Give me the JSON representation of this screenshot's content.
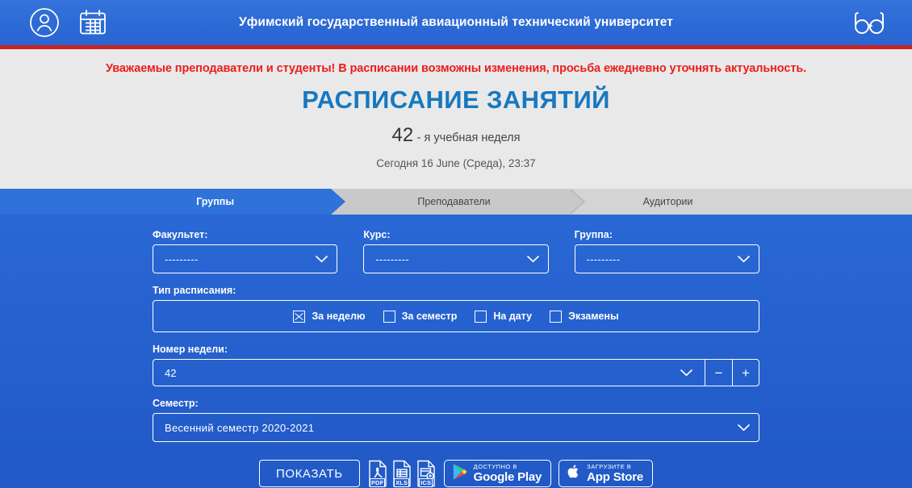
{
  "header": {
    "title": "Уфимский государственный авиационный технический университет",
    "user_icon": "user-circle-icon",
    "calendar_icon": "calendar-icon",
    "accessibility_icon": "glasses-icon",
    "bg_color": "#2c6ad6",
    "rule_color": "#cb2424"
  },
  "notice": {
    "text": "Уважаемые преподаватели и студенты! В расписании возможны изменения, просьба ежедневно уточнять актуальность.",
    "color": "#ee1c1c"
  },
  "page": {
    "title": "РАСПИСАНИЕ ЗАНЯТИЙ",
    "title_color": "#1778c0",
    "week_number": "42",
    "week_suffix": "- я учебная неделя",
    "today": "Сегодня 16 June (Среда), 23:37"
  },
  "tabs": [
    {
      "label": "Группы",
      "active": true
    },
    {
      "label": "Преподаватели",
      "active": false
    },
    {
      "label": "Аудитории",
      "active": false
    }
  ],
  "form": {
    "faculty": {
      "label": "Факультет:",
      "value": "---------"
    },
    "course": {
      "label": "Курс:",
      "value": "---------"
    },
    "group": {
      "label": "Группа:",
      "value": "---------"
    },
    "schedule_type": {
      "label": "Тип расписания:",
      "options": [
        {
          "label": "За неделю",
          "checked": true
        },
        {
          "label": "За семестр",
          "checked": false
        },
        {
          "label": "На дату",
          "checked": false
        },
        {
          "label": "Экзамены",
          "checked": false
        }
      ]
    },
    "week_number": {
      "label": "Номер недели:",
      "value": "42",
      "decrement": "−",
      "increment": "+"
    },
    "semester": {
      "label": "Семестр:",
      "value": "Весенний семестр 2020-2021"
    }
  },
  "actions": {
    "show_button": "ПОКАЗАТЬ",
    "exports": [
      {
        "label": "PDF"
      },
      {
        "label": "XLS"
      },
      {
        "label": "ICS"
      }
    ],
    "google_play": {
      "top": "Доступно в",
      "bottom": "Google Play"
    },
    "app_store": {
      "top": "Загрузите в",
      "bottom": "App Store"
    }
  },
  "colors": {
    "body_blue": "#2662cf",
    "panel_gray": "#e9e9e9",
    "tab_gray": "#c9c9c9"
  }
}
